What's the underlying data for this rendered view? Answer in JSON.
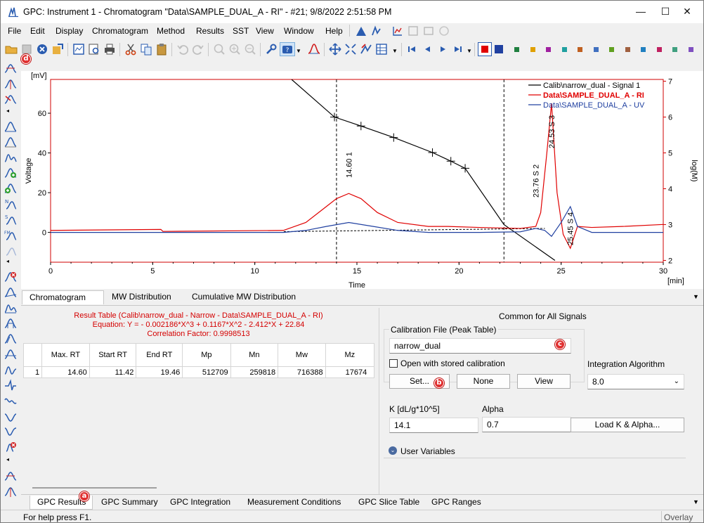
{
  "window": {
    "title": "GPC: Instrument 1 - Chromatogram \"Data\\SAMPLE_DUAL_A - RI\" - #21;   9/8/2022   2:51:58 PM",
    "controls": [
      "—",
      "☐",
      "✕"
    ]
  },
  "menu": {
    "items": [
      "File",
      "Edit",
      "Display",
      "Chromatogram",
      "Method",
      "Results",
      "SST",
      "View",
      "Window",
      "Help"
    ]
  },
  "toolbar": {
    "icons": [
      "open-folder-icon",
      "save-icon",
      "close-icon",
      "export-icon",
      "report-icon",
      "print-preview-icon",
      "print-icon",
      "cut-icon",
      "copy-icon",
      "paste-icon",
      "undo-icon",
      "redo-icon",
      "zoom-in-icon",
      "zoom-window-icon",
      "zoom-out-icon",
      "settings-wrench-icon",
      "help-icon",
      "peak-icon",
      "move-icon",
      "fit-icon",
      "edit-icon",
      "table-icon",
      "first-icon",
      "previous-icon",
      "next-icon",
      "last-icon"
    ],
    "signal_colors": [
      "#e00000",
      "#2040a0",
      "#208040",
      "#e0a000",
      "#a020a0",
      "#20a0a0",
      "#c06020",
      "#4070c0",
      "#60a020",
      "#a06040",
      "#2080c0",
      "#c02060",
      "#40a080",
      "#8050c0",
      "#c0a020"
    ]
  },
  "chart_data": {
    "type": "line",
    "xlabel": "Time",
    "xunit": "[min]",
    "ylabel_left": "Voltage",
    "yunit_left": "[mV]",
    "ylabel_right": "log(M)",
    "xlim": [
      0,
      30
    ],
    "ylim_left": [
      -15,
      77
    ],
    "ylim_right": [
      1.95,
      7.05
    ],
    "x_ticks": [
      0,
      5,
      10,
      15,
      20,
      25,
      30
    ],
    "y_ticks_left": [
      0,
      20,
      40,
      60
    ],
    "y_ticks_right": [
      2,
      3,
      4,
      5,
      6,
      7
    ],
    "legend_position": "top-right",
    "legend": [
      {
        "name": "Calib\\narrow_dual - Signal 1",
        "color": "#000000"
      },
      {
        "name": "Data\\SAMPLE_DUAL_A - RI",
        "color": "#e00000"
      },
      {
        "name": "Data\\SAMPLE_DUAL_A - UV",
        "color": "#2040a0"
      }
    ],
    "series": [
      {
        "color": "#000000",
        "axis": "right",
        "x": [
          11.8,
          13.9,
          15.2,
          16.8,
          18.7,
          19.6,
          20.3,
          22.2,
          24.7
        ],
        "y": [
          7.05,
          6.0,
          5.75,
          5.43,
          5.01,
          4.77,
          4.57,
          3.0,
          2.0
        ]
      },
      {
        "color": "#e00000",
        "axis": "left",
        "x": [
          0,
          5.4,
          5.5,
          11.4,
          12.5,
          13.5,
          14.0,
          14.6,
          15.2,
          16.0,
          17.0,
          18.5,
          19.46,
          21.0,
          23.0,
          23.76,
          24.0,
          24.3,
          24.53,
          24.8,
          25.1,
          25.45,
          25.8,
          26.5,
          28.0,
          30.0
        ],
        "y": [
          1,
          1.5,
          0.5,
          1,
          5,
          13,
          17,
          19.6,
          17,
          10,
          5,
          3,
          3,
          2.5,
          2,
          3,
          10,
          40,
          65,
          20,
          -1,
          -8,
          3,
          2.5,
          3,
          4
        ]
      },
      {
        "color": "#2040a0",
        "axis": "left",
        "x": [
          0,
          11.4,
          12.5,
          13.5,
          14.6,
          15.8,
          17.0,
          18.5,
          21.0,
          23.0,
          23.76,
          24.2,
          24.53,
          25.0,
          25.45,
          25.8,
          26.5,
          30.0
        ],
        "y": [
          0,
          0,
          1,
          3,
          5,
          3,
          1,
          0,
          0,
          0.3,
          2,
          1,
          -2,
          5,
          13,
          3,
          0,
          0
        ]
      }
    ],
    "baseline": {
      "x": [
        11.42,
        24.2
      ],
      "y": [
        0.4,
        2
      ]
    },
    "markers": [
      14.0,
      22.2
    ],
    "peak_labels": [
      {
        "rt": "14.60",
        "id": "1",
        "x": 14.6
      },
      {
        "rt": "23.76",
        "id": "S 2",
        "x": 23.76
      },
      {
        "rt": "24.53",
        "id": "S 3",
        "x": 24.53
      },
      {
        "rt": "25.45",
        "id": "S 4",
        "x": 25.45
      }
    ]
  },
  "chart_tabs": [
    "Chromatogram",
    "MW Distribution",
    "Cumulative MW Distribution"
  ],
  "results": {
    "title": "Result Table (Calib\\narrow_dual - Narrow - Data\\SAMPLE_DUAL_A - RI)",
    "equation": "Equation: Y =  - 0.002186*X^3 + 0.1167*X^2 - 2.412*X + 22.84",
    "correlation": "Correlation Factor: 0.9998513",
    "columns": [
      "",
      "Max. RT",
      "Start RT",
      "End RT",
      "Mp",
      "Mn",
      "Mw",
      "Mz"
    ],
    "rows": [
      [
        "1",
        "14.60",
        "11.42",
        "19.46",
        "512709",
        "259818",
        "716388",
        "17674"
      ]
    ]
  },
  "settings": {
    "header": "Common for All Signals",
    "calibration_label": "Calibration File (Peak Table)",
    "calibration_value": "narrow_dual",
    "stored_calibration": "Open with stored calibration",
    "set_button": "Set...",
    "none_button": "None",
    "view_button": "View",
    "integration_label": "Integration Algorithm",
    "integration_value": "8.0",
    "k_label": "K [dL/g*10^5]",
    "k_value": "14.1",
    "alpha_label": "Alpha",
    "alpha_value": "0.7",
    "load_button": "Load K & Alpha...",
    "user_variables": "User Variables"
  },
  "bottom_tabs": [
    "GPC Results",
    "GPC Summary",
    "GPC Integration",
    "Measurement Conditions",
    "GPC Slice Table",
    "GPC Ranges"
  ],
  "status": {
    "help": "For help press F1.",
    "overlay": "Overlay"
  },
  "callouts": [
    "a",
    "b",
    "c",
    "d"
  ]
}
